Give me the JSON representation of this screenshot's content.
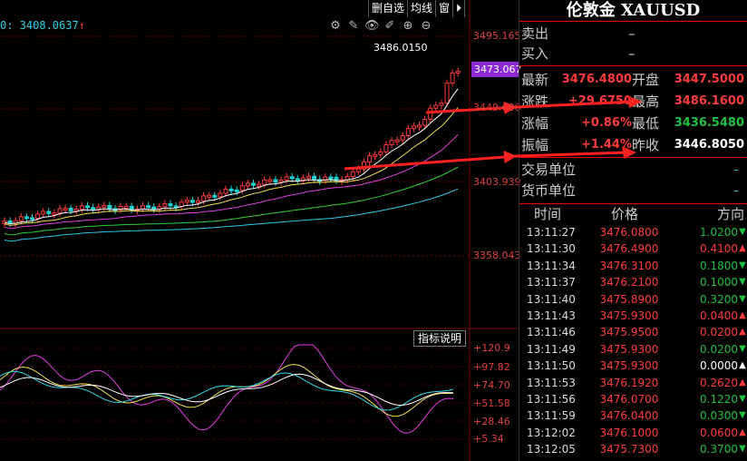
{
  "toolbar": {
    "buttons": [
      "删自选",
      "均线",
      "窗",
      "⏵"
    ]
  },
  "chart": {
    "current_label": "0: 3408.0637",
    "up_arrow": "↑",
    "high_annotation": "3486.0150",
    "price_tag": "3473.067",
    "y_labels": [
      "3495.165",
      "3449.686",
      "3403.939",
      "3358.043"
    ],
    "ind_button": "指标说明",
    "ind_labels": [
      "+120.9",
      "+97.82",
      "+74.70",
      "+51.58",
      "+28.46",
      "+5.34"
    ]
  },
  "panel": {
    "title": "伦敦金 XAUUSD",
    "ask_label": "卖出",
    "ask_value": "–",
    "bid_label": "买入",
    "bid_value": "–",
    "quote": [
      {
        "l1": "最新",
        "v1": "3476.4800",
        "l2": "开盘",
        "v2": "3447.5000",
        "c2": "up"
      },
      {
        "l1": "涨跌",
        "v1": "+29.6750",
        "l2": "最高",
        "v2": "3486.1600",
        "c2": "up"
      },
      {
        "l1": "涨幅",
        "v1": "+0.86%",
        "l2": "最低",
        "v2": "3436.5480",
        "c2": "dn"
      },
      {
        "l1": "振幅",
        "v1": "+1.44%",
        "l2": "昨收",
        "v2": "3446.8050",
        "c2": "eq"
      }
    ],
    "units": [
      {
        "label": "交易单位",
        "value": "–"
      },
      {
        "label": "货币单位",
        "value": "–"
      }
    ],
    "ticks_header": [
      "时间",
      "价格",
      "方向"
    ],
    "ticks": [
      {
        "time": "13:11:27",
        "price": "3476.0800",
        "vol": "1.0200",
        "dir": "dn"
      },
      {
        "time": "13:11:30",
        "price": "3476.4900",
        "vol": "0.4100",
        "dir": "up"
      },
      {
        "time": "13:11:34",
        "price": "3476.3100",
        "vol": "0.1800",
        "dir": "dn"
      },
      {
        "time": "13:11:37",
        "price": "3476.2100",
        "vol": "0.1000",
        "dir": "dn"
      },
      {
        "time": "13:11:40",
        "price": "3475.8900",
        "vol": "0.3200",
        "dir": "dn"
      },
      {
        "time": "13:11:43",
        "price": "3475.9300",
        "vol": "0.0400",
        "dir": "up"
      },
      {
        "time": "13:11:46",
        "price": "3475.9500",
        "vol": "0.0200",
        "dir": "up"
      },
      {
        "time": "13:11:49",
        "price": "3475.9300",
        "vol": "0.0200",
        "dir": "dn"
      },
      {
        "time": "13:11:50",
        "price": "3475.9300",
        "vol": "0.0000",
        "dir": "eq"
      },
      {
        "time": "13:11:53",
        "price": "3476.1920",
        "vol": "0.2620",
        "dir": "up"
      },
      {
        "time": "13:11:56",
        "price": "3476.0700",
        "vol": "0.1220",
        "dir": "dn"
      },
      {
        "time": "13:11:59",
        "price": "3476.0400",
        "vol": "0.0300",
        "dir": "dn"
      },
      {
        "time": "13:12:02",
        "price": "3476.1000",
        "vol": "0.0600",
        "dir": "up"
      },
      {
        "time": "13:12:05",
        "price": "3475.7300",
        "vol": "0.3700",
        "dir": "dn"
      }
    ]
  }
}
